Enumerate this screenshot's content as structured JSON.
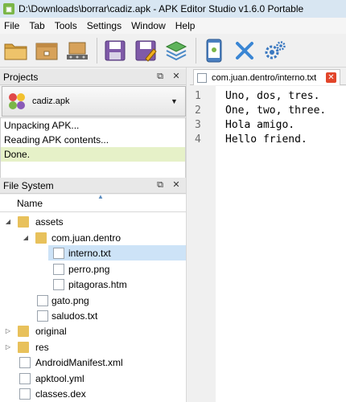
{
  "window": {
    "title": "D:\\Downloads\\borrar\\cadiz.apk - APK Editor Studio v1.6.0 Portable"
  },
  "menu": [
    "File",
    "Tab",
    "Tools",
    "Settings",
    "Window",
    "Help"
  ],
  "toolbar": {
    "icons": [
      "open-folder-icon",
      "open-apk-icon",
      "install-icon",
      "save-icon",
      "save-as-icon",
      "layers-icon",
      "device-icon",
      "close-icon",
      "settings-icon"
    ]
  },
  "projects": {
    "header": "Projects",
    "selected": "cadiz.apk",
    "log": [
      "Unpacking APK...",
      "Reading APK contents...",
      "Done."
    ]
  },
  "filesystem": {
    "header": "File System",
    "column": "Name",
    "rows": [
      {
        "label": "assets",
        "type": "folder",
        "expanded": true
      },
      {
        "label": "com.juan.dentro",
        "type": "folder",
        "expanded": true
      },
      {
        "label": "interno.txt",
        "type": "file",
        "selected": true
      },
      {
        "label": "perro.png",
        "type": "file"
      },
      {
        "label": "pitagoras.htm",
        "type": "file"
      },
      {
        "label": "gato.png",
        "type": "file"
      },
      {
        "label": "saludos.txt",
        "type": "file"
      },
      {
        "label": "original",
        "type": "folder"
      },
      {
        "label": "res",
        "type": "folder"
      },
      {
        "label": "AndroidManifest.xml",
        "type": "file"
      },
      {
        "label": "apktool.yml",
        "type": "file"
      },
      {
        "label": "classes.dex",
        "type": "file"
      }
    ]
  },
  "editor": {
    "tab_label": "com.juan.dentro/interno.txt",
    "line_numbers": [
      "1",
      "2",
      "3",
      "4"
    ],
    "lines": [
      "Uno, dos, tres.",
      "One, two, three.",
      "Hola amigo.",
      "Hello friend."
    ]
  }
}
